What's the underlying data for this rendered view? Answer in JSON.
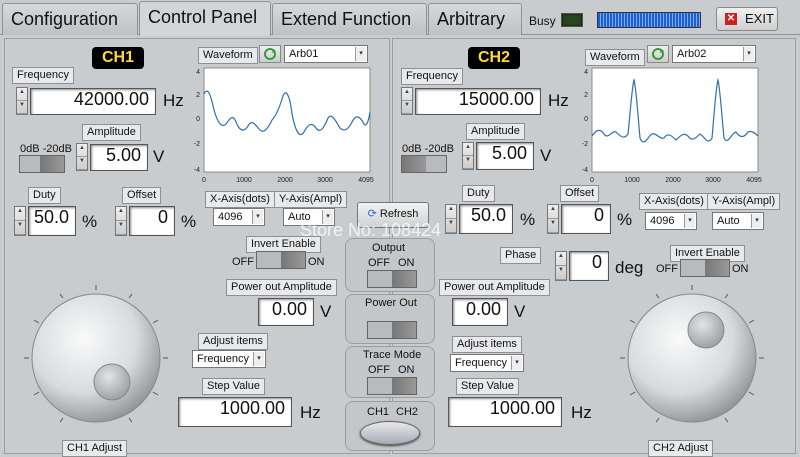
{
  "tabs": [
    {
      "label": "Configuration"
    },
    {
      "label": "Control Panel"
    },
    {
      "label": "Extend Function"
    },
    {
      "label": "Arbitrary"
    }
  ],
  "header": {
    "busy_label": "Busy",
    "exit_label": "EXIT",
    "exit_icon": "close-icon",
    "busy_led_color": "#27461f",
    "progress_color": "#1d5fd8"
  },
  "ch1": {
    "title": "CH1",
    "frequency_label": "Frequency",
    "frequency_value": "42000.00",
    "frequency_unit": "Hz",
    "waveform_label": "Waveform",
    "waveform_value": "Arb01",
    "attenuator_label": "0dB -20dB",
    "amplitude_label": "Amplitude",
    "amplitude_value": "5.00",
    "amplitude_unit": "V",
    "duty_label": "Duty",
    "duty_value": "50.0",
    "duty_unit": "%",
    "offset_label": "Offset",
    "offset_value": "0",
    "offset_unit": "%",
    "xaxis_label": "X-Axis(dots)",
    "xaxis_value": "4096",
    "yaxis_label": "Y-Axis(Ampl)",
    "yaxis_value": "Auto",
    "invert_label": "Invert Enable",
    "invert_off": "OFF",
    "invert_on": "ON",
    "power_out_amp_label": "Power out Amplitude",
    "power_out_amp_value": "0.00",
    "power_out_amp_unit": "V",
    "adjust_items_label": "Adjust items",
    "adjust_items_value": "Frequency",
    "step_label": "Step Value",
    "step_value": "1000.00",
    "step_unit": "Hz",
    "knob_label": "CH1 Adjust",
    "graph_y_ticks": [
      "4",
      "2",
      "0",
      "-2",
      "-4"
    ],
    "graph_x_ticks": [
      "0",
      "1000",
      "2000",
      "3000",
      "4095"
    ]
  },
  "ch2": {
    "title": "CH2",
    "frequency_label": "Frequency",
    "frequency_value": "15000.00",
    "frequency_unit": "Hz",
    "waveform_label": "Waveform",
    "waveform_value": "Arb02",
    "attenuator_label": "0dB -20dB",
    "amplitude_label": "Amplitude",
    "amplitude_value": "5.00",
    "amplitude_unit": "V",
    "duty_label": "Duty",
    "duty_value": "50.0",
    "duty_unit": "%",
    "offset_label": "Offset",
    "offset_value": "0",
    "offset_unit": "%",
    "xaxis_label": "X-Axis(dots)",
    "xaxis_value": "4096",
    "yaxis_label": "Y-Axis(Ampl)",
    "yaxis_value": "Auto",
    "phase_label": "Phase",
    "phase_value": "0",
    "phase_unit": "deg",
    "invert_label": "Invert Enable",
    "invert_off": "OFF",
    "invert_on": "ON",
    "power_out_amp_label": "Power out Amplitude",
    "power_out_amp_value": "0.00",
    "power_out_amp_unit": "V",
    "adjust_items_label": "Adjust items",
    "adjust_items_value": "Frequency",
    "step_label": "Step Value",
    "step_value": "1000.00",
    "step_unit": "Hz",
    "knob_label": "CH2 Adjust",
    "graph_y_ticks": [
      "4",
      "2",
      "0",
      "-2",
      "-4"
    ],
    "graph_x_ticks": [
      "0",
      "1000",
      "2000",
      "3000",
      "4095"
    ]
  },
  "center": {
    "refresh_label": "Refresh",
    "output_label": "Output",
    "output_off": "OFF",
    "output_on": "ON",
    "power_out_label": "Power Out",
    "power_off": "OFF",
    "power_on": "ON",
    "trace_label": "Trace Mode",
    "trace_off": "OFF",
    "trace_on": "ON",
    "ch1_label": "CH1",
    "ch2_label": "CH2"
  },
  "watermark": "Store No: 108424"
}
